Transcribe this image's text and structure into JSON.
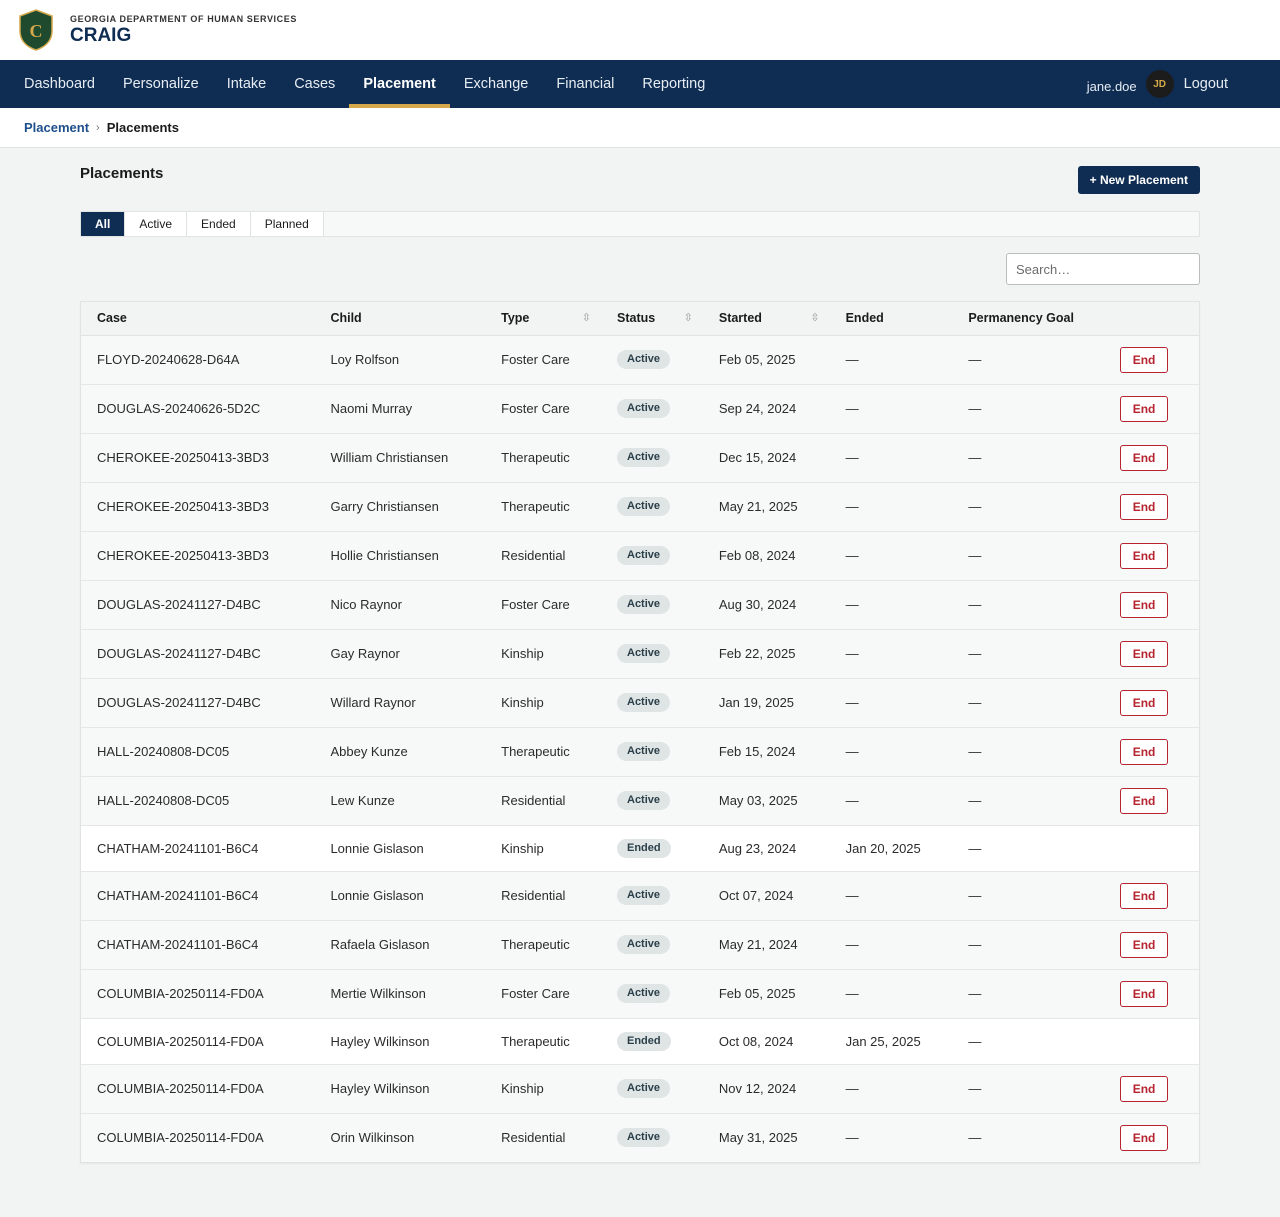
{
  "header": {
    "agency": "GEORGIA DEPARTMENT OF HUMAN SERVICES",
    "app_name": "CRAIG",
    "logo_letter": "C",
    "logo_icon": "shield-logo-icon"
  },
  "nav": {
    "items": [
      {
        "label": "Dashboard",
        "active": false
      },
      {
        "label": "Personalize",
        "active": false
      },
      {
        "label": "Intake",
        "active": false
      },
      {
        "label": "Cases",
        "active": false
      },
      {
        "label": "Placement",
        "active": true
      },
      {
        "label": "Exchange",
        "active": false
      },
      {
        "label": "Financial",
        "active": false
      },
      {
        "label": "Reporting",
        "active": false
      }
    ],
    "user": {
      "name": "jane.doe",
      "initials": "JD"
    },
    "logout_label": "Logout"
  },
  "breadcrumb": {
    "parent": "Placement",
    "separator": "›",
    "current": "Placements"
  },
  "page": {
    "title": "Placements",
    "new_button_label": "+ New Placement",
    "tabs": [
      {
        "label": "All",
        "active": true
      },
      {
        "label": "Active",
        "active": false
      },
      {
        "label": "Ended",
        "active": false
      },
      {
        "label": "Planned",
        "active": false
      }
    ],
    "search_placeholder": "Search…"
  },
  "table": {
    "columns": [
      {
        "label": "Case",
        "sortable": false
      },
      {
        "label": "Child",
        "sortable": false
      },
      {
        "label": "Type",
        "sortable": true
      },
      {
        "label": "Status",
        "sortable": true
      },
      {
        "label": "Started",
        "sortable": true
      },
      {
        "label": "Ended",
        "sortable": false
      },
      {
        "label": "Permanency Goal",
        "sortable": false
      },
      {
        "label": "",
        "sortable": false
      }
    ],
    "sort_icon": "⇳",
    "end_button_label": "End",
    "rows": [
      {
        "case": "FLOYD-20240628-D64A",
        "child": "Loy Rolfson",
        "type": "Foster Care",
        "status": "Active",
        "started": "Feb 05, 2025",
        "ended": "—",
        "goal": "—"
      },
      {
        "case": "DOUGLAS-20240626-5D2C",
        "child": "Naomi Murray",
        "type": "Foster Care",
        "status": "Active",
        "started": "Sep 24, 2024",
        "ended": "—",
        "goal": "—"
      },
      {
        "case": "CHEROKEE-20250413-3BD3",
        "child": "William Christiansen",
        "type": "Therapeutic",
        "status": "Active",
        "started": "Dec 15, 2024",
        "ended": "—",
        "goal": "—"
      },
      {
        "case": "CHEROKEE-20250413-3BD3",
        "child": "Garry Christiansen",
        "type": "Therapeutic",
        "status": "Active",
        "started": "May 21, 2025",
        "ended": "—",
        "goal": "—"
      },
      {
        "case": "CHEROKEE-20250413-3BD3",
        "child": "Hollie Christiansen",
        "type": "Residential",
        "status": "Active",
        "started": "Feb 08, 2024",
        "ended": "—",
        "goal": "—"
      },
      {
        "case": "DOUGLAS-20241127-D4BC",
        "child": "Nico Raynor",
        "type": "Foster Care",
        "status": "Active",
        "started": "Aug 30, 2024",
        "ended": "—",
        "goal": "—"
      },
      {
        "case": "DOUGLAS-20241127-D4BC",
        "child": "Gay Raynor",
        "type": "Kinship",
        "status": "Active",
        "started": "Feb 22, 2025",
        "ended": "—",
        "goal": "—"
      },
      {
        "case": "DOUGLAS-20241127-D4BC",
        "child": "Willard Raynor",
        "type": "Kinship",
        "status": "Active",
        "started": "Jan 19, 2025",
        "ended": "—",
        "goal": "—"
      },
      {
        "case": "HALL-20240808-DC05",
        "child": "Abbey Kunze",
        "type": "Therapeutic",
        "status": "Active",
        "started": "Feb 15, 2024",
        "ended": "—",
        "goal": "—"
      },
      {
        "case": "HALL-20240808-DC05",
        "child": "Lew Kunze",
        "type": "Residential",
        "status": "Active",
        "started": "May 03, 2025",
        "ended": "—",
        "goal": "—"
      },
      {
        "case": "CHATHAM-20241101-B6C4",
        "child": "Lonnie Gislason",
        "type": "Kinship",
        "status": "Ended",
        "started": "Aug 23, 2024",
        "ended": "Jan 20, 2025",
        "goal": "—"
      },
      {
        "case": "CHATHAM-20241101-B6C4",
        "child": "Lonnie Gislason",
        "type": "Residential",
        "status": "Active",
        "started": "Oct 07, 2024",
        "ended": "—",
        "goal": "—"
      },
      {
        "case": "CHATHAM-20241101-B6C4",
        "child": "Rafaela Gislason",
        "type": "Therapeutic",
        "status": "Active",
        "started": "May 21, 2024",
        "ended": "—",
        "goal": "—"
      },
      {
        "case": "COLUMBIA-20250114-FD0A",
        "child": "Mertie Wilkinson",
        "type": "Foster Care",
        "status": "Active",
        "started": "Feb 05, 2025",
        "ended": "—",
        "goal": "—"
      },
      {
        "case": "COLUMBIA-20250114-FD0A",
        "child": "Hayley Wilkinson",
        "type": "Therapeutic",
        "status": "Ended",
        "started": "Oct 08, 2024",
        "ended": "Jan 25, 2025",
        "goal": "—"
      },
      {
        "case": "COLUMBIA-20250114-FD0A",
        "child": "Hayley Wilkinson",
        "type": "Kinship",
        "status": "Active",
        "started": "Nov 12, 2024",
        "ended": "—",
        "goal": "—"
      },
      {
        "case": "COLUMBIA-20250114-FD0A",
        "child": "Orin Wilkinson",
        "type": "Residential",
        "status": "Active",
        "started": "May 31, 2025",
        "ended": "—",
        "goal": "—"
      }
    ]
  },
  "colors": {
    "navy": "#0f2d52",
    "gold": "#d4a84b",
    "danger": "#b5242f",
    "background": "#f1f4f3"
  }
}
